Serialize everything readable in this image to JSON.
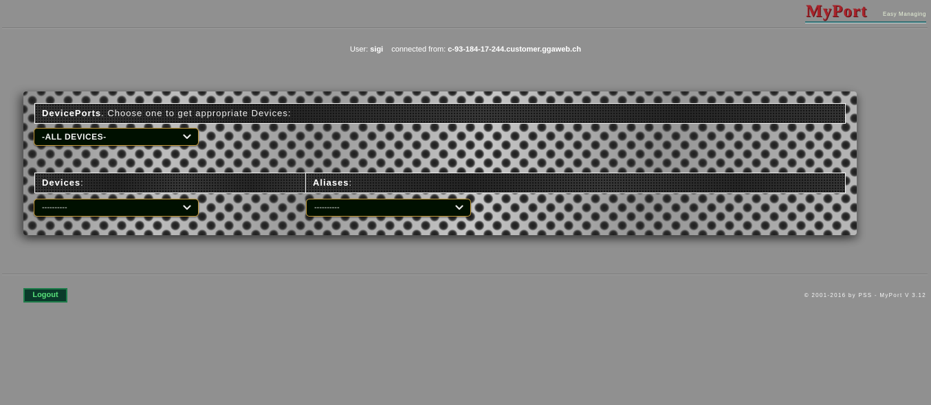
{
  "logo": {
    "brand": "MyPort",
    "tagline": "Easy Managing"
  },
  "userline": {
    "user_label": "User:",
    "user_name": "sigi",
    "connected_label": "connected from:",
    "host": "c-93-184-17-244.customer.ggaweb.ch"
  },
  "panel": {
    "deviceports_title": "DevicePorts",
    "deviceports_text": ". Choose one to get appropriate Devices:",
    "deviceports_select": "-ALL DEVICES-",
    "devices_title": "Devices",
    "devices_colon": ":",
    "devices_select": "----------",
    "aliases_title": "Aliases",
    "aliases_colon": ":",
    "aliases_select": "----------"
  },
  "footer": {
    "logout_label": "Logout",
    "copyright": "© 2001-2016 by PSS - MyPort V 3.12"
  },
  "colors": {
    "page_bg": "#909090",
    "select_border": "#c79b3a",
    "select_bg": "#001000",
    "logout_text": "#58e07a",
    "logo_red": "#a8232a"
  },
  "icons": {
    "select_arrow": "chevron-down-icon"
  }
}
